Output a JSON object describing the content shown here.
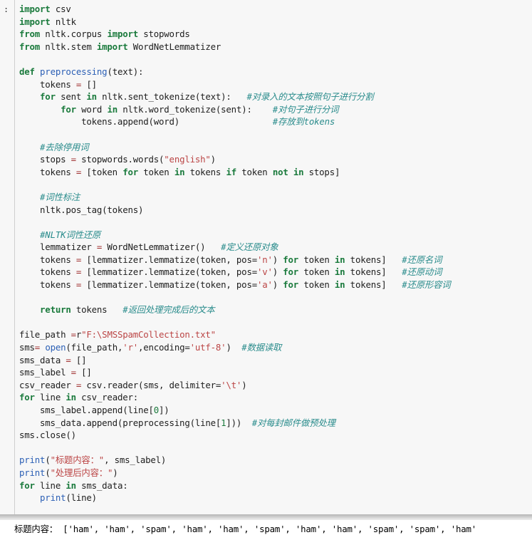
{
  "cell": {
    "prompt_label": ":",
    "lines": [
      [
        {
          "t": "import",
          "c": "kw"
        },
        {
          "t": " csv",
          "c": "pl"
        }
      ],
      [
        {
          "t": "import",
          "c": "kw"
        },
        {
          "t": " nltk",
          "c": "pl"
        }
      ],
      [
        {
          "t": "from",
          "c": "kw"
        },
        {
          "t": " nltk.corpus ",
          "c": "pl"
        },
        {
          "t": "import",
          "c": "kw"
        },
        {
          "t": " stopwords",
          "c": "pl"
        }
      ],
      [
        {
          "t": "from",
          "c": "kw"
        },
        {
          "t": " nltk.stem ",
          "c": "pl"
        },
        {
          "t": "import",
          "c": "kw"
        },
        {
          "t": " WordNetLemmatizer",
          "c": "pl"
        }
      ],
      [],
      [
        {
          "t": "def",
          "c": "kw"
        },
        {
          "t": " ",
          "c": "pl"
        },
        {
          "t": "preprocessing",
          "c": "fn"
        },
        {
          "t": "(text):",
          "c": "pl"
        }
      ],
      [
        {
          "t": "    tokens ",
          "c": "pl"
        },
        {
          "t": "=",
          "c": "op"
        },
        {
          "t": " []",
          "c": "pl"
        }
      ],
      [
        {
          "t": "    ",
          "c": "pl"
        },
        {
          "t": "for",
          "c": "kw"
        },
        {
          "t": " sent ",
          "c": "pl"
        },
        {
          "t": "in",
          "c": "kw"
        },
        {
          "t": " nltk.sent_tokenize(text):   ",
          "c": "pl"
        },
        {
          "t": "#对录入的文本按照句子进行分割",
          "c": "cmt"
        }
      ],
      [
        {
          "t": "        ",
          "c": "pl"
        },
        {
          "t": "for",
          "c": "kw"
        },
        {
          "t": " word ",
          "c": "pl"
        },
        {
          "t": "in",
          "c": "kw"
        },
        {
          "t": " nltk.word_tokenize(sent):    ",
          "c": "pl"
        },
        {
          "t": "#对句子进行分词",
          "c": "cmt"
        }
      ],
      [
        {
          "t": "            tokens.append(word)                  ",
          "c": "pl"
        },
        {
          "t": "#存放到tokens",
          "c": "cmt"
        }
      ],
      [],
      [
        {
          "t": "    ",
          "c": "pl"
        },
        {
          "t": "#去除停用词",
          "c": "cmt"
        }
      ],
      [
        {
          "t": "    stops ",
          "c": "pl"
        },
        {
          "t": "=",
          "c": "op"
        },
        {
          "t": " stopwords.words(",
          "c": "pl"
        },
        {
          "t": "\"english\"",
          "c": "str"
        },
        {
          "t": ")",
          "c": "pl"
        }
      ],
      [
        {
          "t": "    tokens ",
          "c": "pl"
        },
        {
          "t": "=",
          "c": "op"
        },
        {
          "t": " [token ",
          "c": "pl"
        },
        {
          "t": "for",
          "c": "kw"
        },
        {
          "t": " token ",
          "c": "pl"
        },
        {
          "t": "in",
          "c": "kw"
        },
        {
          "t": " tokens ",
          "c": "pl"
        },
        {
          "t": "if",
          "c": "kw"
        },
        {
          "t": " token ",
          "c": "pl"
        },
        {
          "t": "not",
          "c": "kw"
        },
        {
          "t": " ",
          "c": "pl"
        },
        {
          "t": "in",
          "c": "kw"
        },
        {
          "t": " stops]",
          "c": "pl"
        }
      ],
      [],
      [
        {
          "t": "    ",
          "c": "pl"
        },
        {
          "t": "#词性标注",
          "c": "cmt"
        }
      ],
      [
        {
          "t": "    nltk.pos_tag(tokens)",
          "c": "pl"
        }
      ],
      [],
      [
        {
          "t": "    ",
          "c": "pl"
        },
        {
          "t": "#NLTK词性还原",
          "c": "cmt"
        }
      ],
      [
        {
          "t": "    lemmatizer ",
          "c": "pl"
        },
        {
          "t": "=",
          "c": "op"
        },
        {
          "t": " WordNetLemmatizer()   ",
          "c": "pl"
        },
        {
          "t": "#定义还原对象",
          "c": "cmt"
        }
      ],
      [
        {
          "t": "    tokens ",
          "c": "pl"
        },
        {
          "t": "=",
          "c": "op"
        },
        {
          "t": " [lemmatizer.lemmatize(token, pos=",
          "c": "pl"
        },
        {
          "t": "'n'",
          "c": "str"
        },
        {
          "t": ") ",
          "c": "pl"
        },
        {
          "t": "for",
          "c": "kw"
        },
        {
          "t": " token ",
          "c": "pl"
        },
        {
          "t": "in",
          "c": "kw"
        },
        {
          "t": " tokens]   ",
          "c": "pl"
        },
        {
          "t": "#还原名词",
          "c": "cmt"
        }
      ],
      [
        {
          "t": "    tokens ",
          "c": "pl"
        },
        {
          "t": "=",
          "c": "op"
        },
        {
          "t": " [lemmatizer.lemmatize(token, pos=",
          "c": "pl"
        },
        {
          "t": "'v'",
          "c": "str"
        },
        {
          "t": ") ",
          "c": "pl"
        },
        {
          "t": "for",
          "c": "kw"
        },
        {
          "t": " token ",
          "c": "pl"
        },
        {
          "t": "in",
          "c": "kw"
        },
        {
          "t": " tokens]   ",
          "c": "pl"
        },
        {
          "t": "#还原动词",
          "c": "cmt"
        }
      ],
      [
        {
          "t": "    tokens ",
          "c": "pl"
        },
        {
          "t": "=",
          "c": "op"
        },
        {
          "t": " [lemmatizer.lemmatize(token, pos=",
          "c": "pl"
        },
        {
          "t": "'a'",
          "c": "str"
        },
        {
          "t": ") ",
          "c": "pl"
        },
        {
          "t": "for",
          "c": "kw"
        },
        {
          "t": " token ",
          "c": "pl"
        },
        {
          "t": "in",
          "c": "kw"
        },
        {
          "t": " tokens]   ",
          "c": "pl"
        },
        {
          "t": "#还原形容词",
          "c": "cmt"
        }
      ],
      [],
      [
        {
          "t": "    ",
          "c": "pl"
        },
        {
          "t": "return",
          "c": "kw"
        },
        {
          "t": " tokens   ",
          "c": "pl"
        },
        {
          "t": "#返回处理完成后的文本",
          "c": "cmt"
        }
      ],
      [],
      [
        {
          "t": "file_path ",
          "c": "pl"
        },
        {
          "t": "=",
          "c": "op"
        },
        {
          "t": "r",
          "c": "pl"
        },
        {
          "t": "\"F:\\SMSSpamCollection.txt\"",
          "c": "str"
        }
      ],
      [
        {
          "t": "sms",
          "c": "pl"
        },
        {
          "t": "=",
          "c": "op"
        },
        {
          "t": " ",
          "c": "pl"
        },
        {
          "t": "open",
          "c": "fn"
        },
        {
          "t": "(file_path,",
          "c": "pl"
        },
        {
          "t": "'r'",
          "c": "str"
        },
        {
          "t": ",encoding=",
          "c": "pl"
        },
        {
          "t": "'utf-8'",
          "c": "str"
        },
        {
          "t": ")  ",
          "c": "pl"
        },
        {
          "t": "#数据读取",
          "c": "cmt"
        }
      ],
      [
        {
          "t": "sms_data ",
          "c": "pl"
        },
        {
          "t": "=",
          "c": "op"
        },
        {
          "t": " []",
          "c": "pl"
        }
      ],
      [
        {
          "t": "sms_label ",
          "c": "pl"
        },
        {
          "t": "=",
          "c": "op"
        },
        {
          "t": " []",
          "c": "pl"
        }
      ],
      [
        {
          "t": "csv_reader ",
          "c": "pl"
        },
        {
          "t": "=",
          "c": "op"
        },
        {
          "t": " csv.reader(sms, delimiter=",
          "c": "pl"
        },
        {
          "t": "'\\t'",
          "c": "str"
        },
        {
          "t": ")",
          "c": "pl"
        }
      ],
      [
        {
          "t": "for",
          "c": "kw"
        },
        {
          "t": " line ",
          "c": "pl"
        },
        {
          "t": "in",
          "c": "kw"
        },
        {
          "t": " csv_reader:",
          "c": "pl"
        }
      ],
      [
        {
          "t": "    sms_label.append(line[",
          "c": "pl"
        },
        {
          "t": "0",
          "c": "num"
        },
        {
          "t": "])",
          "c": "pl"
        }
      ],
      [
        {
          "t": "    sms_data.append(preprocessing(line[",
          "c": "pl"
        },
        {
          "t": "1",
          "c": "num"
        },
        {
          "t": "]))  ",
          "c": "pl"
        },
        {
          "t": "#对每封邮件做预处理",
          "c": "cmt"
        }
      ],
      [
        {
          "t": "sms.close()",
          "c": "pl"
        }
      ],
      [],
      [
        {
          "t": "print",
          "c": "fn"
        },
        {
          "t": "(",
          "c": "pl"
        },
        {
          "t": "\"标题内容：\"",
          "c": "str"
        },
        {
          "t": ", sms_label)",
          "c": "pl"
        }
      ],
      [
        {
          "t": "print",
          "c": "fn"
        },
        {
          "t": "(",
          "c": "pl"
        },
        {
          "t": "\"处理后内容：\"",
          "c": "str"
        },
        {
          "t": ")",
          "c": "pl"
        }
      ],
      [
        {
          "t": "for",
          "c": "kw"
        },
        {
          "t": " line ",
          "c": "pl"
        },
        {
          "t": "in",
          "c": "kw"
        },
        {
          "t": " sms_data:",
          "c": "pl"
        }
      ],
      [
        {
          "t": "    ",
          "c": "pl"
        },
        {
          "t": "print",
          "c": "fn"
        },
        {
          "t": "(line)",
          "c": "pl"
        }
      ]
    ]
  },
  "output": {
    "text": "标题内容： ['ham', 'ham', 'spam', 'ham', 'ham', 'spam', 'ham', 'ham', 'spam', 'spam', 'ham'"
  },
  "colors": {
    "cell_background": "#f7f7f7",
    "page_background": "#ffffff",
    "keyword": "#1a7a3c",
    "function": "#2b5fb5",
    "string": "#bb4545",
    "comment": "#2a8c8c",
    "operator": "#a03030",
    "plain_text": "#202020",
    "cell_border": "#cfcfcf",
    "separator_bar": "#b5b5b5"
  }
}
